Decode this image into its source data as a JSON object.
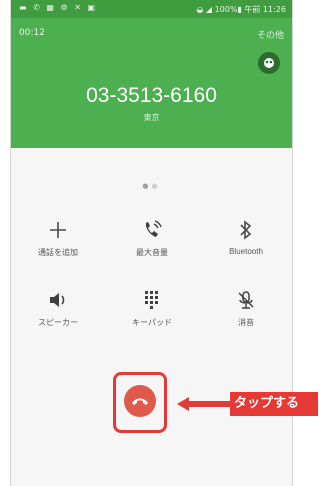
{
  "status_bar": {
    "left_icons": [
      "message-icon",
      "phone-icon",
      "calendar-icon",
      "gear-icon",
      "mute-icon",
      "image-icon"
    ],
    "right_text": "100%▮ 午前 11:26",
    "battery": "100%",
    "time": "午前 11:26"
  },
  "call": {
    "timer": "00:12",
    "more_label": "その他",
    "number": "03-3513-6160",
    "location": "東京"
  },
  "controls": [
    {
      "id": "add-call",
      "label": "通話を追加",
      "icon": "plus-icon"
    },
    {
      "id": "extra-volume",
      "label": "最大音量",
      "icon": "volume-boost-icon"
    },
    {
      "id": "bluetooth",
      "label": "Bluetooth",
      "icon": "bluetooth-icon"
    },
    {
      "id": "speaker",
      "label": "スピーカー",
      "icon": "speaker-icon"
    },
    {
      "id": "keypad",
      "label": "キーパッド",
      "icon": "keypad-icon"
    },
    {
      "id": "mute",
      "label": "消音",
      "icon": "mic-off-icon"
    }
  ],
  "annotation": {
    "callout_text": "タップする"
  },
  "colors": {
    "header_green": "#4caf50",
    "status_green": "#3f9c3f",
    "hangup_red": "#e05a4b",
    "annotation_red": "#e53935"
  }
}
